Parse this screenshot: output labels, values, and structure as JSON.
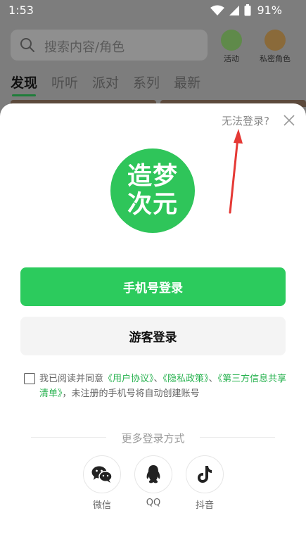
{
  "status_bar": {
    "time": "1:53",
    "battery_percent": "91%",
    "icons": [
      "wifi-icon",
      "signal-icon",
      "battery-icon"
    ]
  },
  "background_app": {
    "search_placeholder": "搜索内容/角色",
    "activities": [
      {
        "label": "活动",
        "icon": "activity-icon"
      },
      {
        "label": "私密角色",
        "icon": "private-character-icon"
      }
    ],
    "tabs": [
      "发现",
      "听听",
      "派对",
      "系列",
      "最新"
    ],
    "active_tab": "发现"
  },
  "login_sheet": {
    "cant_login_label": "无法登录?",
    "logo_text": "造梦次元",
    "phone_login_label": "手机号登录",
    "guest_login_label": "游客登录",
    "agreement": {
      "prefix": "我已阅读并同意",
      "user_agreement": "《用户协议》",
      "sep1": "、",
      "privacy_policy": "《隐私政策》",
      "sep2": "、",
      "third_party_list": "《第三方信息共享清单》",
      "suffix": "，未注册的手机号将自动创建账号",
      "checked": false
    },
    "more_methods_label": "更多登录方式",
    "social": [
      {
        "label": "微信",
        "icon": "wechat-icon"
      },
      {
        "label": "QQ",
        "icon": "qq-icon"
      },
      {
        "label": "抖音",
        "icon": "douyin-icon"
      }
    ]
  },
  "colors": {
    "brand_green": "#2ccb5d",
    "link_green": "#27b24f",
    "annotation_red": "#e53935"
  }
}
